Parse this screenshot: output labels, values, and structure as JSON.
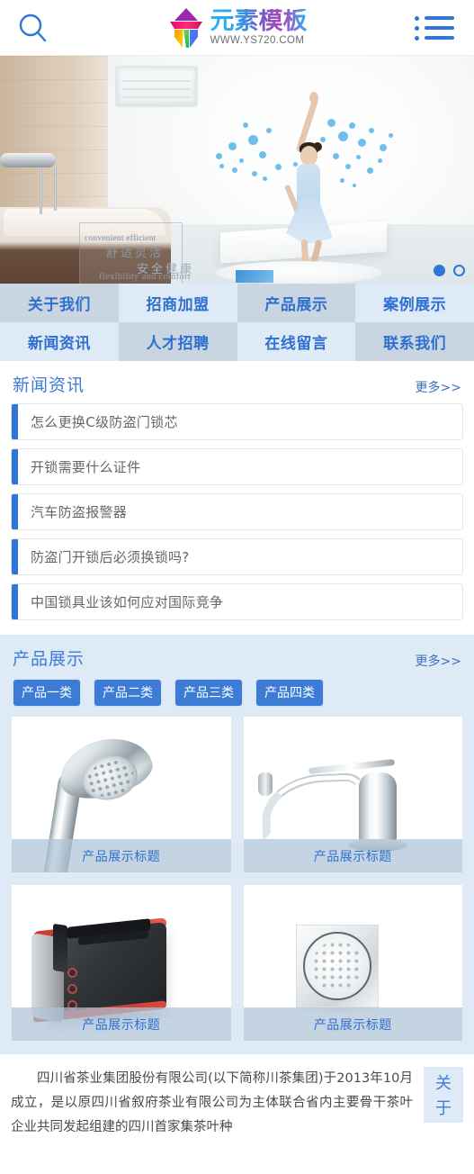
{
  "header": {
    "search_icon": "search-icon",
    "menu_icon": "list-menu-icon",
    "logo_cn": "元素模板",
    "logo_url": "WWW.YS720.COM"
  },
  "banner": {
    "line_en_top": "convenient efficient",
    "line_cn_top": "舒适灵活",
    "line_cn_bottom": "安全健康",
    "line_en_bottom": "flexibility and comfort",
    "dots": [
      "active",
      "inactive"
    ]
  },
  "nav": {
    "items": [
      {
        "label": "关于我们",
        "shade": "a"
      },
      {
        "label": "招商加盟",
        "shade": "b"
      },
      {
        "label": "产品展示",
        "shade": "a"
      },
      {
        "label": "案例展示",
        "shade": "b"
      },
      {
        "label": "新闻资讯",
        "shade": "b"
      },
      {
        "label": "人才招聘",
        "shade": "a"
      },
      {
        "label": "在线留言",
        "shade": "b"
      },
      {
        "label": "联系我们",
        "shade": "a"
      }
    ]
  },
  "news": {
    "title": "新闻资讯",
    "more": "更多>>",
    "items": [
      "怎么更换C级防盗门锁芯",
      "开锁需要什么证件",
      "汽车防盗报警器",
      "防盗门开锁后必须换锁吗?",
      "中国锁具业该如何应对国际竞争"
    ]
  },
  "products": {
    "title": "产品展示",
    "more": "更多>>",
    "tabs": [
      "产品一类",
      "产品二类",
      "产品三类",
      "产品四类"
    ],
    "cards": [
      {
        "caption": "产品展示标题",
        "art": "shower-head"
      },
      {
        "caption": "产品展示标题",
        "art": "kitchen-faucet"
      },
      {
        "caption": "产品展示标题",
        "art": "toaster"
      },
      {
        "caption": "产品展示标题",
        "art": "shower-panel"
      }
    ]
  },
  "about": {
    "text": "四川省茶业集团股份有限公司(以下简称川茶集团)于2013年10月成立，是以原四川省叙府茶业有限公司为主体联合省内主要骨干茶叶企业共同发起组建的四川首家集茶叶种",
    "tab_char_1": "关",
    "tab_char_2": "于"
  },
  "colors": {
    "brand_blue": "#2f76d6",
    "title_blue": "#3d7cd6",
    "nav_light": "#dfeaf7",
    "nav_dark": "#c9d6e2",
    "caption_overlay": "rgba(175,195,215,.72)"
  }
}
